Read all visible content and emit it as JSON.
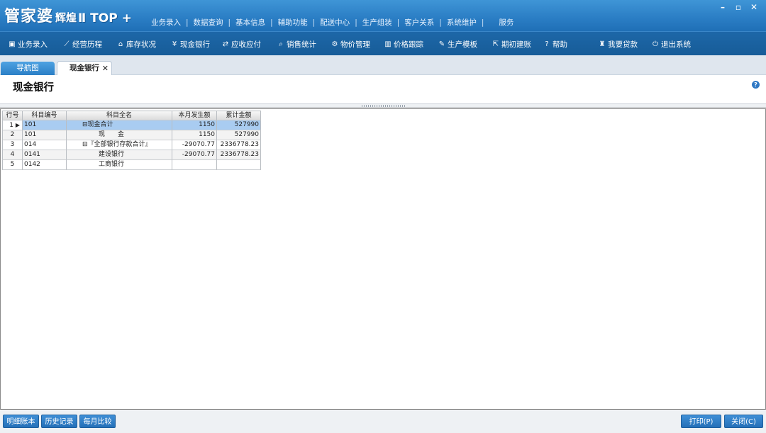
{
  "app": {
    "brand_main": "管家婆",
    "brand_sub": "辉煌",
    "brand_ver": "Ⅱ TOP +"
  },
  "top_menu": [
    "业务录入",
    "数据查询",
    "基本信息",
    "辅助功能",
    "配送中心",
    "生产组装",
    "客户关系",
    "系统维护",
    "服务"
  ],
  "toolbar": [
    {
      "label": "业务录入",
      "icon": "document-icon"
    },
    {
      "label": "经营历程",
      "icon": "chart-line-icon"
    },
    {
      "label": "库存状况",
      "icon": "warehouse-icon"
    },
    {
      "label": "现金银行",
      "icon": "yen-icon"
    },
    {
      "label": "应收应付",
      "icon": "arrows-icon"
    },
    {
      "label": "销售统计",
      "icon": "search-icon"
    },
    {
      "label": "物价管理",
      "icon": "gear-icon"
    },
    {
      "label": "价格跟踪",
      "icon": "bar-chart-icon"
    },
    {
      "label": "生产模板",
      "icon": "wrench-icon"
    },
    {
      "label": "期初建账",
      "icon": "external-icon"
    },
    {
      "label": "帮助",
      "icon": "question-icon"
    },
    {
      "label": "我要贷款",
      "icon": "money-bag-icon"
    },
    {
      "label": "退出系统",
      "icon": "power-icon"
    }
  ],
  "tabs": {
    "nav": "导航图",
    "active": "现金银行",
    "close": "✕"
  },
  "page_title": "现金银行",
  "table": {
    "headers": [
      "行号",
      "科目编号",
      "科目全名",
      "本月发生额",
      "累计金额"
    ],
    "rows": [
      {
        "no": "1",
        "code": "101",
        "name": "⊟现金合计",
        "amount": "1150",
        "total": "527990"
      },
      {
        "no": "2",
        "code": "101",
        "name": "现　　金",
        "amount": "1150",
        "total": "527990"
      },
      {
        "no": "3",
        "code": "014",
        "name": "⊟『全部银行存款合计』",
        "amount": "-29070.77",
        "total": "2336778.23"
      },
      {
        "no": "4",
        "code": "0141",
        "name": "建设银行",
        "amount": "-29070.77",
        "total": "2336778.23"
      },
      {
        "no": "5",
        "code": "0142",
        "name": "工商银行",
        "amount": "",
        "total": ""
      }
    ]
  },
  "buttons": {
    "detail": "明细账本",
    "history": "历史记录",
    "monthly": "每月比较",
    "print": "打印(P)",
    "close": "关闭(C)"
  },
  "colors": {
    "title_bar": "#2a7dc4",
    "toolbar": "#1d67a8",
    "selected_row": "#a9ccf1"
  }
}
